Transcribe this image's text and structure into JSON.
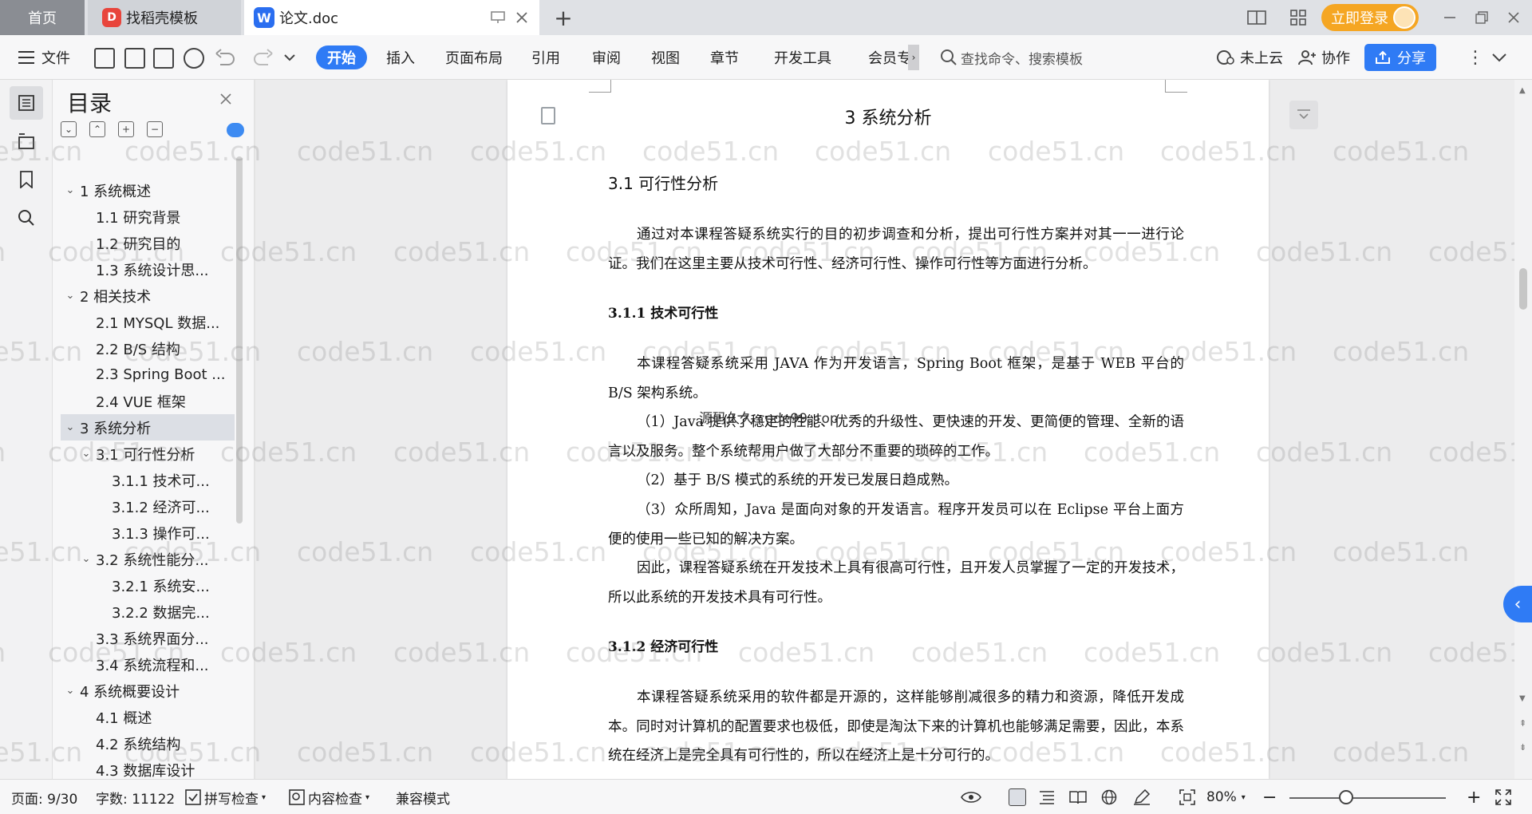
{
  "tabs": {
    "home": "首页",
    "template": "找稻壳模板",
    "doc": "论文.doc",
    "template_logo": "D",
    "doc_logo": "W"
  },
  "titlebar": {
    "login_label": "立即登录",
    "new_tab": "+"
  },
  "ribbon": {
    "file": "文件",
    "start": "开始",
    "insert": "插入",
    "layout": "页面布局",
    "reference": "引用",
    "review": "审阅",
    "view": "视图",
    "chapter": "章节",
    "devtools": "开发工具",
    "member": "会员专",
    "search_placeholder": "查找命令、搜索模板",
    "cloud": "未上云",
    "collab": "协作",
    "share": "分享"
  },
  "outline": {
    "title": "目录",
    "items": [
      {
        "label": "1 系统概述",
        "level": 1,
        "caret": "⌄"
      },
      {
        "label": "1.1  研究背景",
        "level": 2,
        "caret": ""
      },
      {
        "label": "1.2 研究目的",
        "level": 2,
        "caret": ""
      },
      {
        "label": "1.3 系统设计思...",
        "level": 2,
        "caret": ""
      },
      {
        "label": "2 相关技术",
        "level": 1,
        "caret": "⌄"
      },
      {
        "label": "2.1 MYSQL 数据...",
        "level": 2,
        "caret": ""
      },
      {
        "label": "2.2 B/S 结构",
        "level": 2,
        "caret": ""
      },
      {
        "label": "2.3 Spring Boot ...",
        "level": 2,
        "caret": ""
      },
      {
        "label": "2.4 VUE 框架",
        "level": 2,
        "caret": ""
      },
      {
        "label": "3 系统分析",
        "level": 1,
        "caret": "⌄",
        "selected": true
      },
      {
        "label": "3.1 可行性分析",
        "level": 2,
        "caret": "⌄"
      },
      {
        "label": "3.1.1 技术可...",
        "level": 3,
        "caret": ""
      },
      {
        "label": "3.1.2 经济可...",
        "level": 3,
        "caret": ""
      },
      {
        "label": "3.1.3 操作可...",
        "level": 3,
        "caret": ""
      },
      {
        "label": "3.2 系统性能分...",
        "level": 2,
        "caret": "⌄"
      },
      {
        "label": "3.2.1  系统安...",
        "level": 3,
        "caret": ""
      },
      {
        "label": "3.2.2  数据完...",
        "level": 3,
        "caret": ""
      },
      {
        "label": "3.3 系统界面分...",
        "level": 2,
        "caret": ""
      },
      {
        "label": "3.4 系统流程和...",
        "level": 2,
        "caret": ""
      },
      {
        "label": "4 系统概要设计",
        "level": 1,
        "caret": "⌄"
      },
      {
        "label": "4.1 概述",
        "level": 2,
        "caret": ""
      },
      {
        "label": "4.2 系统结构",
        "level": 2,
        "caret": ""
      },
      {
        "label": "4.3 数据库设计",
        "level": 2,
        "caret": ""
      }
    ]
  },
  "document": {
    "h1": "3 系统分析",
    "h2": "3.1 可行性分析",
    "intro": "通过对本课程答疑系统实行的目的初步调查和分析，提出可行性方案并对其一一进行论证。我们在这里主要从技术可行性、经济可行性、操作可行性等方面进行分析。",
    "h3_tech": "3.1.1 技术可行性",
    "tech_p1": "本课程答疑系统采用 JAVA 作为开发语言，Spring Boot 框架，是基于 WEB 平台的 B/S 架构系统。",
    "tech_p2": "（1）Java 提供了稳定的性能、优秀的升级性、更快速的开发、更简便的管理、全新的语言以及服务。整个系统帮用户做了大部分不重要的琐碎的工作。",
    "tech_p3": "（2）基于 B/S 模式的系统的开发已发展日趋成熟。",
    "tech_p4": "（3）众所周知，Java 是面向对象的开发语言。程序开发员可以在 Eclipse 平台上面方便的使用一些已知的解决方案。",
    "tech_p5": "因此，课程答疑系统在开发技术上具有很高可行性，且开发人员掌握了一定的开发技术，所以此系统的开发技术具有可行性。",
    "h3_econ": "3.1.2 经济可行性",
    "econ_p1": "本课程答疑系统采用的软件都是开源的，这样能够削减很多的精力和资源，降低开发成本。同时对计算机的配置要求也极低，即使是淘汰下来的计算机也能够满足需要，因此，本系统在经济上是完全具有可行性的，所以在经济上是十分可行的。",
    "stamp": "源码久久  code99. top"
  },
  "watermark": "code51.cn",
  "statusbar": {
    "page": "页面: 9/30",
    "words": "字数: 11122",
    "spell": "拼写检查",
    "content": "内容检查",
    "compat": "兼容模式",
    "zoom": "80%",
    "zoom_fraction": 0.8
  }
}
